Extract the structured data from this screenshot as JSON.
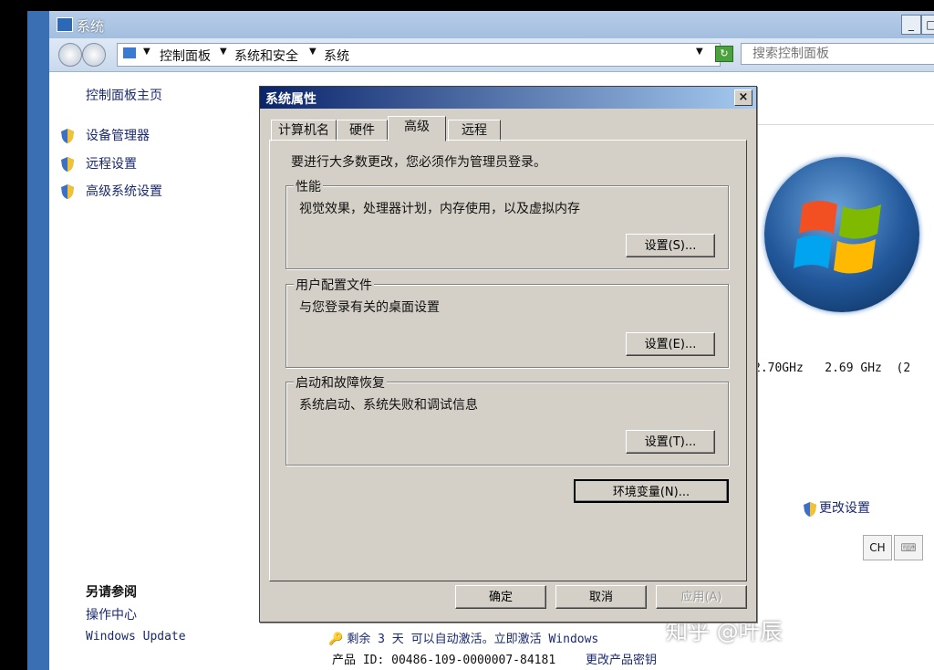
{
  "window": {
    "title": "系统",
    "minimize_label": "_",
    "maximize_label": "□"
  },
  "address": {
    "breadcrumbs": [
      "控制面板",
      "系统和安全",
      "系统"
    ],
    "search_placeholder": "搜索控制面板"
  },
  "sidebar": {
    "home": "控制面板主页",
    "items": [
      {
        "label": "设备管理器",
        "icon": "shield-icon"
      },
      {
        "label": "远程设置",
        "icon": "shield-icon"
      },
      {
        "label": "高级系统设置",
        "icon": "shield-icon"
      }
    ],
    "see_also_title": "另请参阅",
    "see_also": [
      "操作中心",
      "Windows Update"
    ]
  },
  "system_info": {
    "cpu": "2.70GHz   2.69 GHz  (2",
    "change_settings": "更改设置",
    "lang": "CH",
    "activation": "剩余 3 天 可以自动激活。立即激活 Windows",
    "product_id": "产品 ID: 00486-109-0000007-84181",
    "change_key": "更改产品密钥"
  },
  "watermark": "知乎 @叶辰",
  "dialog": {
    "title": "系统属性",
    "close_label": "×",
    "tabs": [
      "计算机名",
      "硬件",
      "高级",
      "远程"
    ],
    "active_tab": "高级",
    "admin_note": "要进行大多数更改，您必须作为管理员登录。",
    "groups": [
      {
        "title": "性能",
        "desc": "视觉效果，处理器计划，内存使用，以及虚拟内存",
        "button": "设置(S)..."
      },
      {
        "title": "用户配置文件",
        "desc": "与您登录有关的桌面设置",
        "button": "设置(E)..."
      },
      {
        "title": "启动和故障恢复",
        "desc": "系统启动、系统失败和调试信息",
        "button": "设置(T)..."
      }
    ],
    "env_button": "环境变量(N)...",
    "ok": "确定",
    "cancel": "取消",
    "apply": "应用(A)"
  },
  "colors": {
    "dialog_title_start": "#0a246a",
    "dialog_title_end": "#a6caf0",
    "link": "#1a2a6e"
  }
}
